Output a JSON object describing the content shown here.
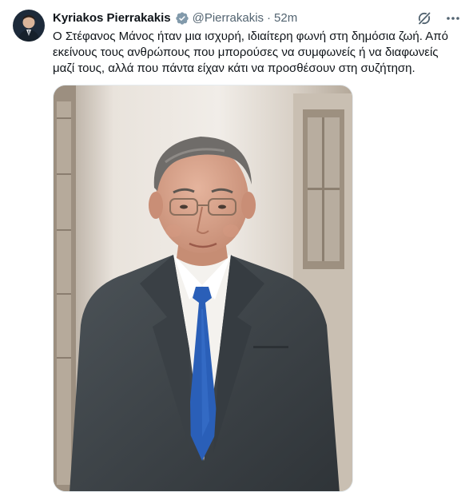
{
  "author": {
    "display_name": "Kyriakos Pierrakakis",
    "handle": "@Pierrakakis",
    "separator": "·",
    "timestamp": "52m",
    "verified_badge_color": "#829aab"
  },
  "header_actions": {
    "grok_icon": "grok-slash-icon",
    "more_icon": "more-dots-icon"
  },
  "tweet": {
    "text_line_1": "Ο Στέφανος Μάνος ήταν μια ισχυρή, ιδιαίτερη φωνή στη δημόσια ζωή. Από",
    "text_line_2": "εκείνους τους ανθρώπους που μπορούσες να συμφωνείς ή να διαφωνείς",
    "text_line_3": "μαζί τους, αλλά που πάντα είχαν κάτι να προσθέσουν στη συζήτηση."
  },
  "colors": {
    "text_primary": "#0f1419",
    "text_secondary": "#536471",
    "tie_blue": "#2a5fb8",
    "suit_gray": "#3d4348"
  }
}
